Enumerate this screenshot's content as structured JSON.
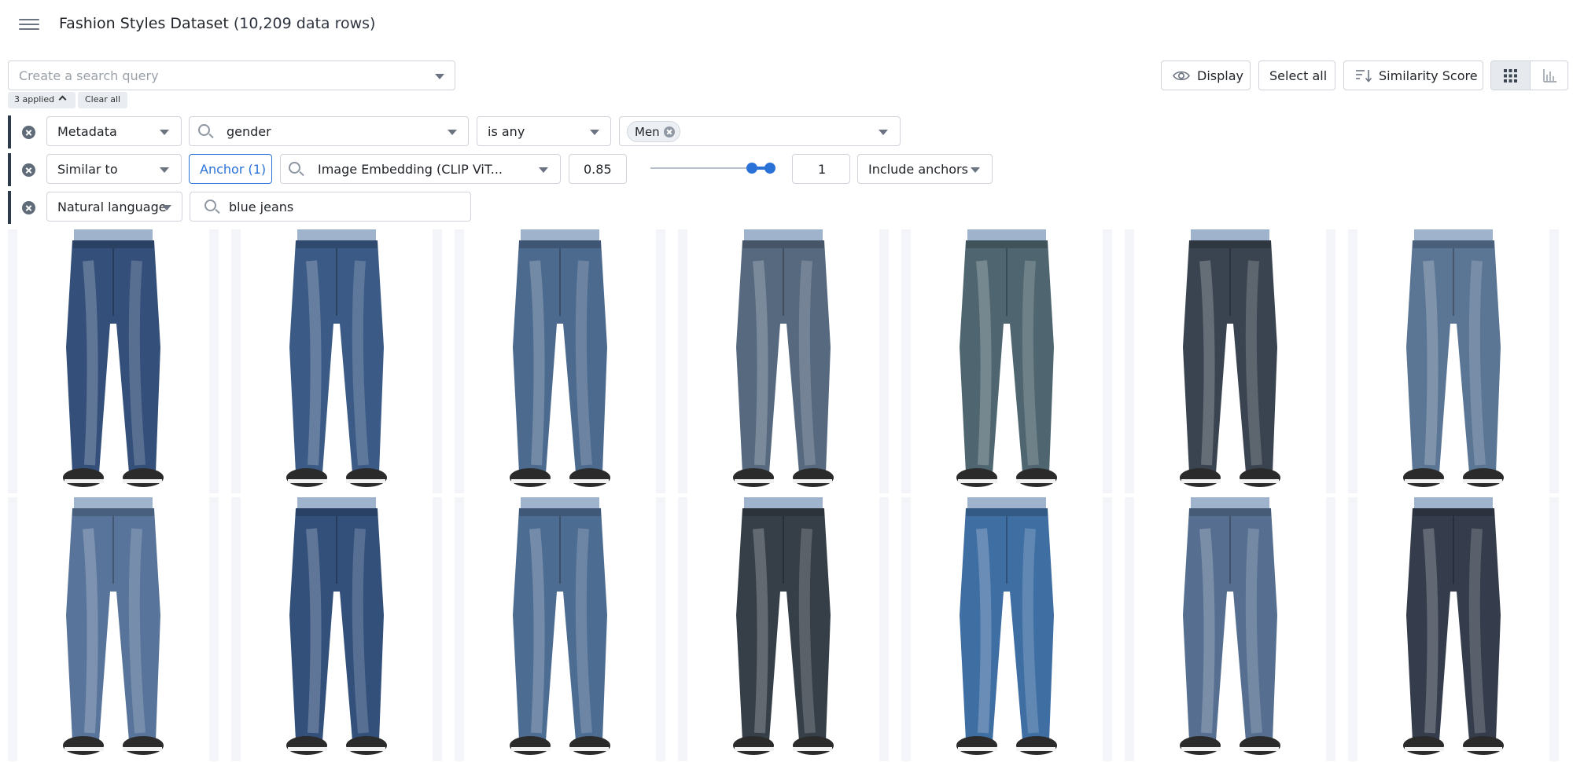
{
  "header": {
    "title": "Fashion Styles Dataset",
    "row_count": "(10,209 data rows)"
  },
  "search": {
    "placeholder": "Create a search query",
    "applied_label": "3 applied",
    "clear_label": "Clear all"
  },
  "toolbar": {
    "display_label": "Display",
    "select_all_label": "Select all",
    "sort_label": "Similarity Score",
    "view_modes": [
      "grid",
      "chart"
    ],
    "active_view": "grid"
  },
  "filters": [
    {
      "type": "Metadata",
      "field": "gender",
      "operator": "is any",
      "values": [
        "Men"
      ]
    },
    {
      "type": "Similar to",
      "anchor_label": "Anchor (1)",
      "embedding": "Image Embedding (CLIP ViT...",
      "threshold": "0.85",
      "slider_range": [
        0.85,
        1
      ],
      "max_value": "1",
      "anchor_option": "Include anchors"
    },
    {
      "type": "Natural language",
      "query": "blue jeans"
    }
  ],
  "results": {
    "items": [
      {
        "name": "jeans-1",
        "color": "#34507a"
      },
      {
        "name": "jeans-2",
        "color": "#3b5b86"
      },
      {
        "name": "jeans-3",
        "color": "#4c6a8e"
      },
      {
        "name": "jeans-4",
        "color": "#56697f"
      },
      {
        "name": "jeans-5",
        "color": "#4f6670"
      },
      {
        "name": "jeans-6",
        "color": "#3a4450"
      },
      {
        "name": "jeans-7",
        "color": "#5b7594"
      },
      {
        "name": "jeans-8",
        "color": "#58749a"
      },
      {
        "name": "jeans-9",
        "color": "#33507b"
      },
      {
        "name": "jeans-10",
        "color": "#4d6c92"
      },
      {
        "name": "jeans-11",
        "color": "#363f48"
      },
      {
        "name": "jeans-12",
        "color": "#3f6ea3"
      },
      {
        "name": "jeans-13",
        "color": "#566f90"
      },
      {
        "name": "jeans-14",
        "color": "#353d4c"
      }
    ]
  }
}
